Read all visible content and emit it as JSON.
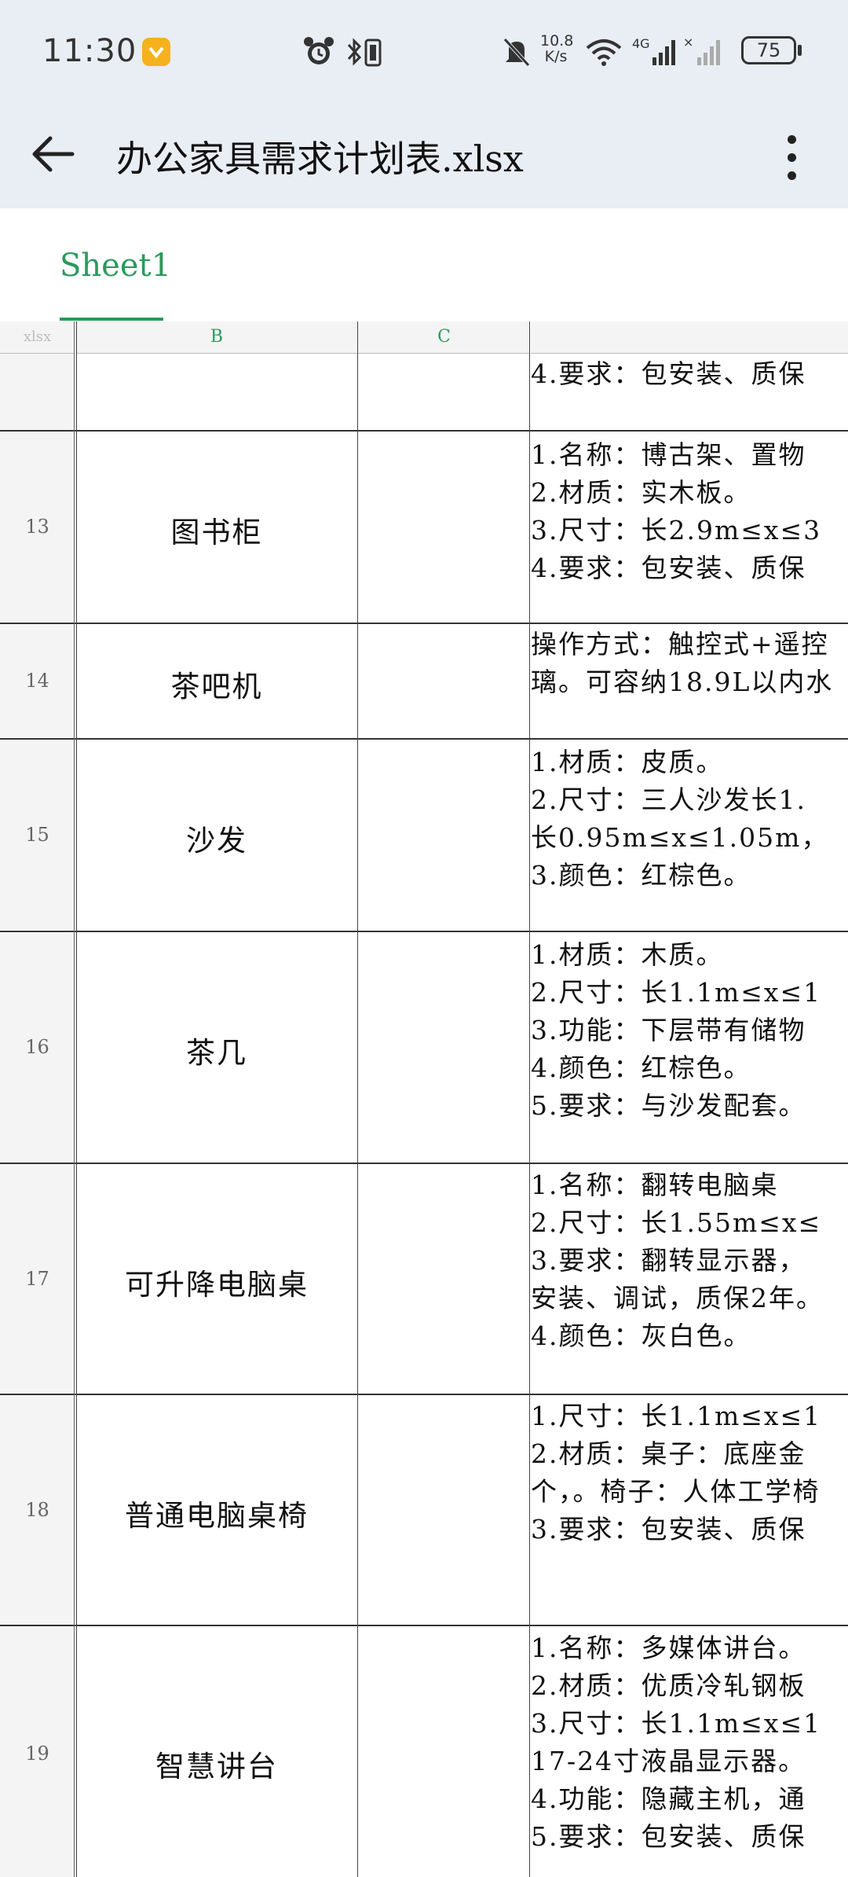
{
  "status_bar": {
    "time": "11:30",
    "net_speed_top": "10.8",
    "net_speed_bottom": "K/s",
    "battery": "75",
    "icons": [
      "app-notification-icon",
      "alarm-icon",
      "bluetooth-icon",
      "mute-icon",
      "wifi-icon",
      "4g-signal-icon",
      "no-signal-icon",
      "battery-icon"
    ]
  },
  "app_bar": {
    "title": "办公家具需求计划表.xlsx",
    "back_icon": "back-arrow-icon",
    "more_icon": "more-vert-icon"
  },
  "tabs": [
    {
      "label": "Sheet1",
      "active": true
    }
  ],
  "columns": {
    "corner": "xlsx",
    "b": "B",
    "c": "C",
    "d": ""
  },
  "rows": [
    {
      "num": "",
      "name": "",
      "lines": [
        "4.要求：包安装、质保"
      ]
    },
    {
      "num": "13",
      "name": "图书柜",
      "lines": [
        "1.名称：博古架、置物",
        "2.材质：实木板。",
        "3.尺寸：长2.9m≤x≤3",
        "4.要求：包安装、质保"
      ]
    },
    {
      "num": "14",
      "name": "茶吧机",
      "lines": [
        "操作方式：触控式+遥控",
        "璃。可容纳18.9L以内水"
      ]
    },
    {
      "num": "15",
      "name": "沙发",
      "lines": [
        "1.材质：皮质。",
        "2.尺寸：三人沙发长1.",
        "长0.95m≤x≤1.05m，",
        "3.颜色：红棕色。"
      ]
    },
    {
      "num": "16",
      "name": "茶几",
      "lines": [
        "1.材质：木质。",
        "2.尺寸：长1.1m≤x≤1",
        "3.功能：下层带有储物",
        "4.颜色：红棕色。",
        "5.要求：与沙发配套。"
      ]
    },
    {
      "num": "17",
      "name": "可升降电脑桌",
      "lines": [
        "1.名称：翻转电脑桌",
        "2.尺寸：长1.55m≤x≤",
        "3.要求：翻转显示器，",
        "安装、调试，质保2年。",
        "4.颜色：灰白色。"
      ]
    },
    {
      "num": "18",
      "name": "普通电脑桌椅",
      "lines": [
        "1.尺寸：长1.1m≤x≤1",
        "2.材质：桌子：底座金",
        "个，。椅子：人体工学椅",
        "3.要求：包安装、质保"
      ]
    },
    {
      "num": "19",
      "name": "智慧讲台",
      "lines": [
        "1.名称：多媒体讲台。",
        "2.材质：优质冷轧钢板",
        "3.尺寸：长1.1m≤x≤1",
        "17-24寸液晶显示器。",
        "4.功能：隐藏主机，通",
        "5.要求：包安装、质保"
      ]
    }
  ]
}
